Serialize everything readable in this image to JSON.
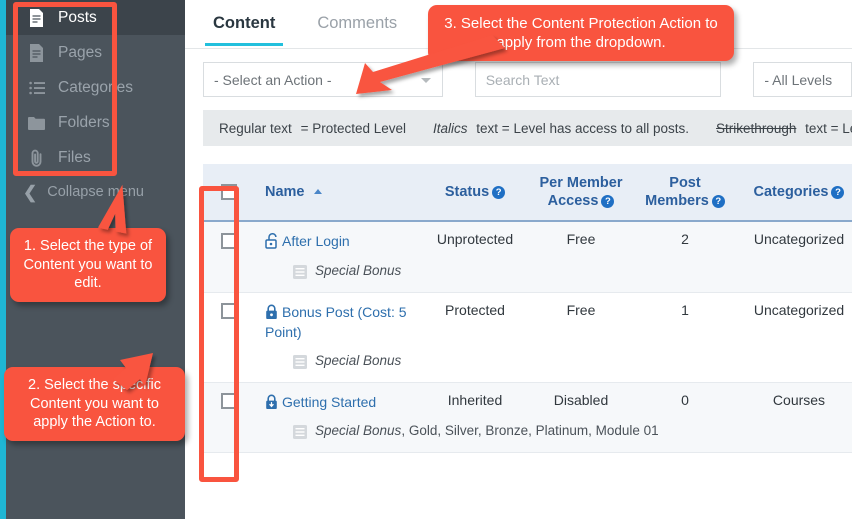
{
  "sidebar": {
    "items": [
      {
        "label": "Posts",
        "icon": "document-icon",
        "active": true
      },
      {
        "label": "Pages",
        "icon": "document-icon",
        "active": false
      },
      {
        "label": "Categories",
        "icon": "list-icon",
        "active": false
      },
      {
        "label": "Folders",
        "icon": "folder-icon",
        "active": false
      },
      {
        "label": "Files",
        "icon": "paperclip-icon",
        "active": false
      }
    ],
    "collapse_label": "Collapse menu",
    "background": "#4b545c",
    "active_background": "#3c444b",
    "accent_strip": "#1fb6d4"
  },
  "tabs": [
    {
      "label": "Content",
      "active": true
    },
    {
      "label": "Comments",
      "active": false
    }
  ],
  "tab_underline_color": "#22c0dd",
  "filters": {
    "action_select_value": "- Select an Action -",
    "search_placeholder": "Search Text",
    "levels_select_value": "- All Levels"
  },
  "legend": {
    "part1_prefix": "Regular text",
    "part1_rest": "= Protected Level",
    "part2_italic": "Italics",
    "part2_rest": "text = Level has access to all posts.",
    "part3_strike": "Strikethrough",
    "part3_rest": "text = Level added but pos"
  },
  "table": {
    "columns": [
      {
        "key": "checkbox",
        "label": "",
        "help": false
      },
      {
        "key": "name",
        "label": "Name",
        "help": false,
        "sorted": "asc"
      },
      {
        "key": "status",
        "label": "Status",
        "help": true
      },
      {
        "key": "access",
        "label": "Per Member Access",
        "help": true
      },
      {
        "key": "post_members",
        "label": "Post Members",
        "help": true
      },
      {
        "key": "categories",
        "label": "Categories",
        "help": true
      }
    ],
    "header_help_color": "#1f6fc4",
    "rows": [
      {
        "name": "After Login",
        "lock": "unlocked",
        "status": "Unprotected",
        "access": "Free",
        "post_members": "2",
        "categories": "Uncategorized",
        "levels_italic": "Special Bonus",
        "levels_regular": ""
      },
      {
        "name": "Bonus Post (Cost: 5 Point)",
        "lock": "locked",
        "status": "Protected",
        "access": "Free",
        "post_members": "1",
        "categories": "Uncategorized",
        "levels_italic": "Special Bonus",
        "levels_regular": ""
      },
      {
        "name": "Getting Started",
        "lock": "inherited",
        "status": "Inherited",
        "access": "Disabled",
        "post_members": "0",
        "categories": "Courses",
        "levels_italic": "Special Bonus",
        "levels_regular": ", Gold, Silver, Bronze, Platinum, Module 01"
      }
    ]
  },
  "annotations": {
    "callout_1": "1. Select the type of Content you want to edit.",
    "callout_2": "2. Select the specific Content you want to apply the Action to.",
    "callout_3": "3. Select the Content Protection Action to apply from the dropdown.",
    "color": "#f9543f"
  }
}
